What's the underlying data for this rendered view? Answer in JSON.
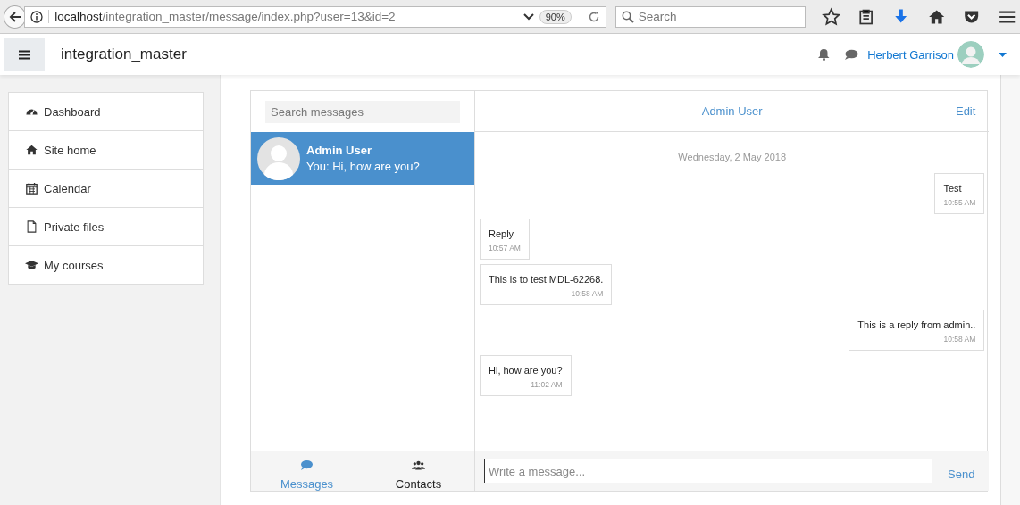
{
  "browser": {
    "url_host": "localhost",
    "url_path": "/integration_master/message/index.php?user=13&id=2",
    "zoom": "90%",
    "search_placeholder": "Search"
  },
  "navbar": {
    "site_name": "integration_master",
    "user_name": "Herbert Garrison"
  },
  "sidebar": {
    "items": [
      {
        "label": "Dashboard",
        "kind": "dashboard"
      },
      {
        "label": "Site home",
        "kind": "home"
      },
      {
        "label": "Calendar",
        "kind": "calendar"
      },
      {
        "label": "Private files",
        "kind": "file"
      },
      {
        "label": "My courses",
        "kind": "courses"
      }
    ]
  },
  "conversations": {
    "search_placeholder": "Search messages",
    "items": [
      {
        "name": "Admin User",
        "preview": "You: Hi, how are you?",
        "selected": true
      }
    ]
  },
  "chat": {
    "title": "Admin User",
    "edit": "Edit",
    "date": "Wednesday, 2 May 2018",
    "messages": [
      {
        "text": "Test",
        "time": "10:55 AM",
        "kind": "sent"
      },
      {
        "text": "Reply",
        "time": "10:57 AM",
        "kind": "received"
      },
      {
        "text": "This is to test MDL-62268.",
        "time": "10:58 AM",
        "kind": "received"
      },
      {
        "text": "This is a reply from admin..",
        "time": "10:58 AM",
        "kind": "sent"
      },
      {
        "text": "Hi, how are you?",
        "time": "11:02 AM",
        "kind": "received"
      }
    ],
    "compose_placeholder": "Write a message...",
    "send": "Send"
  },
  "tabs": [
    {
      "label": "Messages",
      "kind": "messages",
      "selected": true
    },
    {
      "label": "Contacts",
      "kind": "contacts",
      "selected": false
    }
  ]
}
